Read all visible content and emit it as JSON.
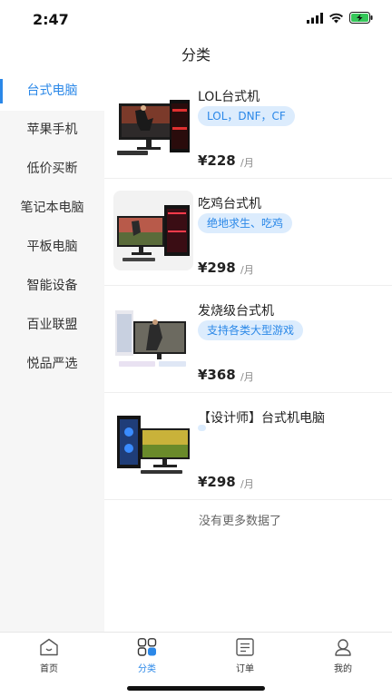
{
  "status": {
    "time": "2:47"
  },
  "header": {
    "title": "分类"
  },
  "sidebar": {
    "items": [
      {
        "label": "台式电脑"
      },
      {
        "label": "苹果手机"
      },
      {
        "label": "低价买断"
      },
      {
        "label": "笔记本电脑"
      },
      {
        "label": "平板电脑"
      },
      {
        "label": "智能设备"
      },
      {
        "label": "百业联盟"
      },
      {
        "label": "悦品严选"
      }
    ]
  },
  "products": [
    {
      "title": "LOL台式机",
      "tag": "LOL，DNF，CF",
      "price": "¥228",
      "unit": "/月"
    },
    {
      "title": "吃鸡台式机",
      "tag": "绝地求生、吃鸡",
      "price": "¥298",
      "unit": "/月"
    },
    {
      "title": "发烧级台式机",
      "tag": "支持各类大型游戏",
      "price": "¥368",
      "unit": "/月"
    },
    {
      "title": "【设计师】台式机电脑",
      "tag": "",
      "price": "¥298",
      "unit": "/月"
    }
  ],
  "footer_text": "没有更多数据了",
  "tabbar": {
    "items": [
      {
        "label": "首页"
      },
      {
        "label": "分类"
      },
      {
        "label": "订单"
      },
      {
        "label": "我的"
      }
    ]
  },
  "colors": {
    "accent": "#2b88e8",
    "tag_bg": "#dcecfd",
    "sidebar_bg": "#f6f6f6"
  }
}
